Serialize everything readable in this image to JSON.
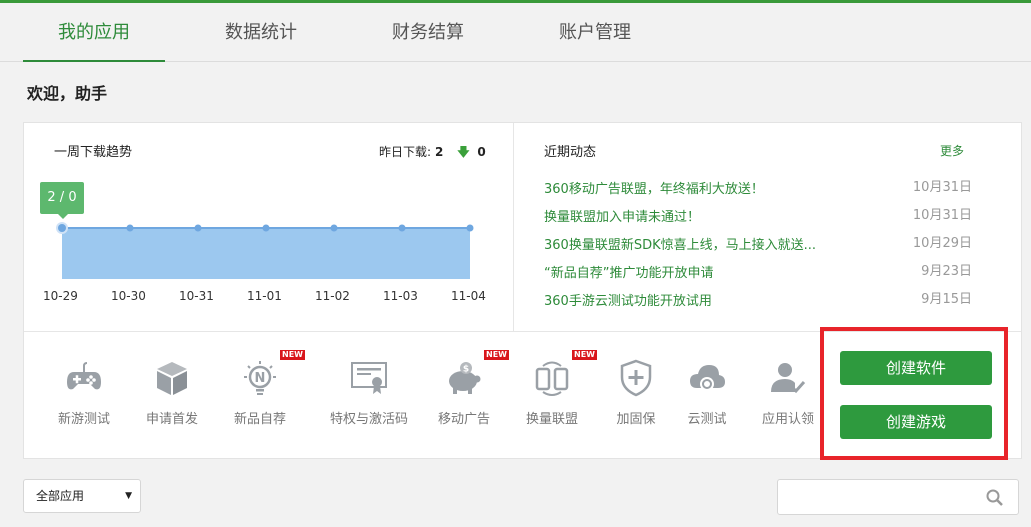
{
  "nav": {
    "tabs": [
      {
        "label": "我的应用"
      },
      {
        "label": "数据统计"
      },
      {
        "label": "财务结算"
      },
      {
        "label": "账户管理"
      }
    ]
  },
  "welcome": "欢迎，助手",
  "trend": {
    "title": "一周下载趋势",
    "yesterday_label": "昨日下载:",
    "yesterday_count": "2",
    "change_value": "0",
    "tooltip": "2 / 0"
  },
  "chart_data": {
    "type": "area",
    "x": [
      "10-29",
      "10-30",
      "10-31",
      "11-01",
      "11-02",
      "11-03",
      "11-04"
    ],
    "series": [
      {
        "values": [
          2,
          2,
          2,
          2,
          2,
          2,
          2
        ]
      }
    ],
    "color": "#9cc8ef",
    "line_color": "#6fa7e0"
  },
  "news": {
    "title": "近期动态",
    "more_label": "更多",
    "items": [
      {
        "text": "360移动广告联盟，年终福利大放送！",
        "date": "10月31日"
      },
      {
        "text": "换量联盟加入申请未通过！",
        "date": "10月31日"
      },
      {
        "text": "360换量联盟新SDK惊喜上线，马上接入就送...",
        "date": "10月29日"
      },
      {
        "text": "“新品自荐”推广功能开放申请",
        "date": "9月23日"
      },
      {
        "text": "360手游云测试功能开放试用",
        "date": "9月15日"
      }
    ]
  },
  "tools": [
    {
      "label": "新游测试",
      "icon": "gamepad-icon"
    },
    {
      "label": "申请首发",
      "icon": "box-icon"
    },
    {
      "label": "新品自荐",
      "icon": "new-bulb-icon",
      "badge": "NEW"
    },
    {
      "label": "特权与激活码",
      "icon": "certificate-icon"
    },
    {
      "label": "移动广告",
      "icon": "piggy-bank-icon",
      "badge": "NEW"
    },
    {
      "label": "换量联盟",
      "icon": "swap-phones-icon",
      "badge": "NEW"
    },
    {
      "label": "加固保",
      "icon": "shield-plus-icon"
    },
    {
      "label": "云测试",
      "icon": "cloud-icon"
    },
    {
      "label": "应用认领",
      "icon": "user-check-icon"
    }
  ],
  "actions": {
    "create_software": "创建软件",
    "create_game": "创建游戏"
  },
  "filter": {
    "selected": "全部应用"
  },
  "search": {
    "placeholder": ""
  }
}
